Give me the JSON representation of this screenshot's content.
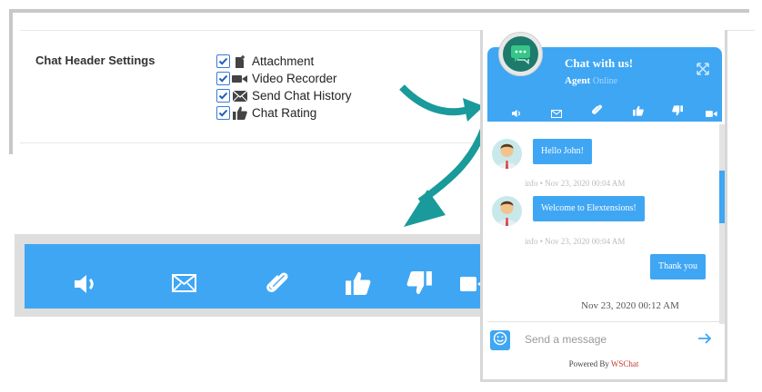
{
  "settings": {
    "label": "Chat Header Settings",
    "options": [
      {
        "label": "Attachment",
        "checked": true,
        "icon": "attachment-icon"
      },
      {
        "label": "Video Recorder",
        "checked": true,
        "icon": "video-icon"
      },
      {
        "label": "Send Chat History",
        "checked": true,
        "icon": "envelope-icon"
      },
      {
        "label": "Chat Rating",
        "checked": true,
        "icon": "thumbs-up-icon"
      }
    ]
  },
  "toolbar_icons": [
    "speaker-icon",
    "envelope-icon",
    "paperclip-icon",
    "thumbs-up-icon",
    "thumbs-down-icon",
    "video-icon"
  ],
  "widget": {
    "title": "Chat with us!",
    "agent_label": "Agent",
    "status": "Online",
    "messages": [
      {
        "side": "agent",
        "text": "Hello John!",
        "meta": "info • Nov 23, 2020 00:04 AM"
      },
      {
        "side": "agent",
        "text": "Welcome to Elextensions!",
        "meta": "info • Nov 23, 2020 00:04 AM"
      },
      {
        "side": "user",
        "text": "Thank you"
      }
    ],
    "timestamp": "Nov 23, 2020 00:12 AM",
    "input_placeholder": "Send a message",
    "powered_prefix": "Powered By",
    "powered_brand": "WSChat"
  },
  "colors": {
    "accent": "#3fa6f4",
    "arrow": "#1a9a9a",
    "brand_red": "#c0392b"
  }
}
